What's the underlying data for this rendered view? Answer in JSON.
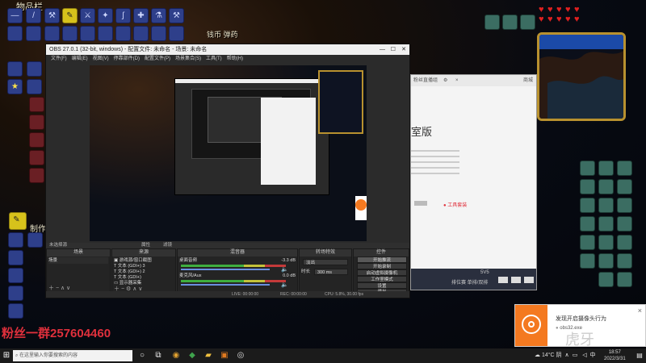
{
  "game": {
    "inventory_label": "物品栏",
    "coins_label": "钱币 弹药",
    "crafting_label": "制作",
    "fan_group_text": "粉丝一群257604460",
    "hearts_count": 10
  },
  "obs": {
    "title": "OBS 27.0.1 (32-bit, windows) - 配置文件: 未命名 - 场景: 未命名",
    "menu": [
      "文件(F)",
      "编辑(E)",
      "视图(V)",
      "停靠部件(D)",
      "配置文件(P)",
      "场景集合(S)",
      "工具(T)",
      "帮助(H)"
    ],
    "no_source_label": "未选择源",
    "properties_button": "属性",
    "filters_button": "滤镜",
    "docks": {
      "scenes_title": "场景",
      "sources_title": "来源",
      "mixer_title": "混音器",
      "transitions_title": "转场特效",
      "controls_title": "控件"
    },
    "scenes": [
      "场景"
    ],
    "sources": [
      "游戏源/窗口截图",
      "文本 (GDI+) 3",
      "文本 (GDI+) 2",
      "文本 (GDI+)",
      "显示器采集"
    ],
    "mixer": [
      {
        "name": "桌面音频",
        "level": "-3.3 dB"
      },
      {
        "name": "麦克风/Aux",
        "level": "0.0 dB"
      }
    ],
    "transitions": {
      "type": "淡出",
      "duration_label": "时长",
      "duration_value": "300 ms"
    },
    "controls": [
      "开始推流",
      "开始录制",
      "启动虚拟摄像机",
      "工作室模式",
      "设置",
      "退出"
    ],
    "status": {
      "live": "LIVE: 00:00:00",
      "rec": "REC: 00:00:00",
      "cpu_fps": "CPU: 5.8%, 30.00 fps"
    }
  },
  "browser_panel": {
    "header_text": "粉丝直播组",
    "app_label": "商城",
    "title_fragment": "室版",
    "footer_button": "工具套装",
    "version": "5V5",
    "bottom_label": "排位赛 单排/双排"
  },
  "notification": {
    "title": "发现开启摄像头行为",
    "subtitle": "obs32.exe",
    "close_label": "×"
  },
  "taskbar": {
    "search_placeholder": "在这里输入你要搜索的内容",
    "weather": "14°C 阴",
    "ime_label": "中",
    "time": "18:57",
    "date": "2022/3/31"
  },
  "watermark": "虎牙"
}
